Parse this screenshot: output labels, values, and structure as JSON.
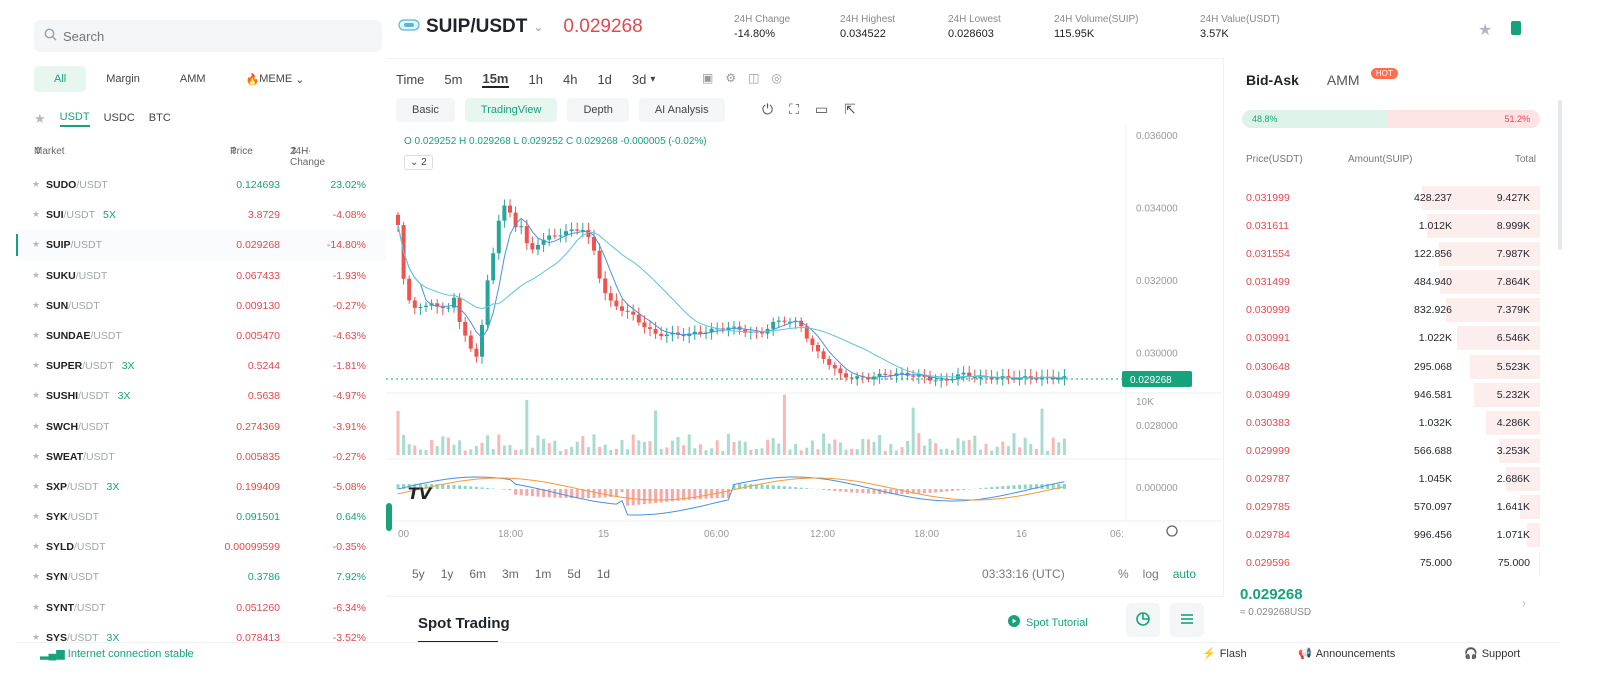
{
  "sidebar": {
    "search_placeholder": "Search",
    "categories": [
      "All",
      "Margin",
      "AMM",
      "MEME"
    ],
    "quotes": [
      "USDT",
      "USDC",
      "BTC"
    ],
    "headers": {
      "market": "Market",
      "price": "Price",
      "change": "24H Change"
    },
    "rows": [
      {
        "sym": "SUDO",
        "quote": "/USDT",
        "lev": "",
        "price": "0.124693",
        "change": "23.02%",
        "dir": "up"
      },
      {
        "sym": "SUI",
        "quote": "/USDT",
        "lev": "5X",
        "price": "3.8729",
        "change": "-4.08%",
        "dir": "down"
      },
      {
        "sym": "SUIP",
        "quote": "/USDT",
        "lev": "",
        "price": "0.029268",
        "change": "-14.80%",
        "dir": "down",
        "selected": true
      },
      {
        "sym": "SUKU",
        "quote": "/USDT",
        "lev": "",
        "price": "0.067433",
        "change": "-1.93%",
        "dir": "down"
      },
      {
        "sym": "SUN",
        "quote": "/USDT",
        "lev": "",
        "price": "0.009130",
        "change": "-0.27%",
        "dir": "down"
      },
      {
        "sym": "SUNDAE",
        "quote": "/USDT",
        "lev": "",
        "price": "0.005470",
        "change": "-4.63%",
        "dir": "down"
      },
      {
        "sym": "SUPER",
        "quote": "/USDT",
        "lev": "3X",
        "price": "0.5244",
        "change": "-1.81%",
        "dir": "down"
      },
      {
        "sym": "SUSHI",
        "quote": "/USDT",
        "lev": "3X",
        "price": "0.5638",
        "change": "-4.97%",
        "dir": "down"
      },
      {
        "sym": "SWCH",
        "quote": "/USDT",
        "lev": "",
        "price": "0.274369",
        "change": "-3.91%",
        "dir": "down"
      },
      {
        "sym": "SWEAT",
        "quote": "/USDT",
        "lev": "",
        "price": "0.005835",
        "change": "-0.27%",
        "dir": "down"
      },
      {
        "sym": "SXP",
        "quote": "/USDT",
        "lev": "3X",
        "price": "0.199409",
        "change": "-5.08%",
        "dir": "down"
      },
      {
        "sym": "SYK",
        "quote": "/USDT",
        "lev": "",
        "price": "0.091501",
        "change": "0.64%",
        "dir": "up"
      },
      {
        "sym": "SYLD",
        "quote": "/USDT",
        "lev": "",
        "price": "0.00099599",
        "change": "-0.35%",
        "dir": "down"
      },
      {
        "sym": "SYN",
        "quote": "/USDT",
        "lev": "",
        "price": "0.3786",
        "change": "7.92%",
        "dir": "up"
      },
      {
        "sym": "SYNT",
        "quote": "/USDT",
        "lev": "",
        "price": "0.051260",
        "change": "-6.34%",
        "dir": "down"
      },
      {
        "sym": "SYS",
        "quote": "/USDT",
        "lev": "3X",
        "price": "0.078413",
        "change": "-3.52%",
        "dir": "down"
      }
    ]
  },
  "header": {
    "pair": "SUIP/USDT",
    "last_price": "0.029268",
    "stats": [
      {
        "label": "24H Change",
        "value": "-14.80%",
        "color": "#e5484d"
      },
      {
        "label": "24H Highest",
        "value": "0.034522"
      },
      {
        "label": "24H Lowest",
        "value": "0.028603"
      },
      {
        "label": "24H Volume(SUIP)",
        "value": "115.95K"
      },
      {
        "label": "24H Value(USDT)",
        "value": "3.57K"
      }
    ]
  },
  "chart_toolbar": {
    "timeframes": [
      "Time",
      "5m",
      "15m",
      "1h",
      "4h",
      "1d",
      "3d"
    ],
    "active_timeframe": "15m",
    "views": [
      "Basic",
      "TradingView",
      "Depth",
      "AI Analysis"
    ],
    "active_view": "TradingView",
    "ohlc": "O 0.029252  H 0.029268  L 0.029252  C 0.029268  -0.000005 (-0.02%)",
    "indicator_toggle": "2",
    "range_buttons": [
      "5y",
      "1y",
      "6m",
      "3m",
      "1m",
      "5d",
      "1d"
    ],
    "clock": "03:33:16 (UTC)",
    "scale_options": [
      "%",
      "log",
      "auto"
    ]
  },
  "chart_data": {
    "type": "candlestick",
    "y_axis_ticks": [
      "0.036000",
      "0.034000",
      "0.032000",
      "0.030000",
      "0.028000"
    ],
    "ylim": [
      0.028,
      0.036
    ],
    "last_price_label": "0.029268",
    "volume_axis_tick": "10K",
    "macd_axis_tick": "0.000000",
    "x_axis_ticks": [
      "00",
      "18:00",
      "15",
      "06:00",
      "12:00",
      "18:00",
      "16",
      "06:"
    ],
    "colors": {
      "up": "#26a69a",
      "down": "#ef5350",
      "ma_fast": "#4a90e2",
      "ma_slow": "#5cc7d6",
      "macd": "#4a90e2",
      "signal": "#f59a3c"
    }
  },
  "spot": {
    "title": "Spot Trading",
    "tutorial": "Spot Tutorial"
  },
  "orderbook": {
    "tabs": [
      "Bid-Ask",
      "AMM"
    ],
    "hot_badge": "HOT",
    "buy_ratio": "48.8%",
    "sell_ratio": "51.2%",
    "buy_pct": 48.8,
    "headers": {
      "price": "Price(USDT)",
      "amount": "Amount(SUIP)",
      "total": "Total"
    },
    "asks": [
      {
        "price": "0.031999",
        "amount": "428.237",
        "total": "9.427K",
        "depth": 0.98
      },
      {
        "price": "0.031611",
        "amount": "1.012K",
        "total": "8.999K",
        "depth": 0.94
      },
      {
        "price": "0.031554",
        "amount": "122.856",
        "total": "7.987K",
        "depth": 0.84
      },
      {
        "price": "0.031499",
        "amount": "484.940",
        "total": "7.864K",
        "depth": 0.83
      },
      {
        "price": "0.030999",
        "amount": "832.926",
        "total": "7.379K",
        "depth": 0.78
      },
      {
        "price": "0.030991",
        "amount": "1.022K",
        "total": "6.546K",
        "depth": 0.69
      },
      {
        "price": "0.030648",
        "amount": "295.068",
        "total": "5.523K",
        "depth": 0.58
      },
      {
        "price": "0.030499",
        "amount": "946.581",
        "total": "5.232K",
        "depth": 0.55
      },
      {
        "price": "0.030383",
        "amount": "1.032K",
        "total": "4.286K",
        "depth": 0.45
      },
      {
        "price": "0.029999",
        "amount": "566.688",
        "total": "3.253K",
        "depth": 0.34
      },
      {
        "price": "0.029787",
        "amount": "1.045K",
        "total": "2.686K",
        "depth": 0.28
      },
      {
        "price": "0.029785",
        "amount": "570.097",
        "total": "1.641K",
        "depth": 0.17
      },
      {
        "price": "0.029784",
        "amount": "996.456",
        "total": "1.071K",
        "depth": 0.11
      },
      {
        "price": "0.029596",
        "amount": "75.000",
        "total": "75.000",
        "depth": 0.01
      }
    ],
    "mid_price": "0.029268",
    "mid_usd": "≈ 0.029268USD"
  },
  "footer": {
    "connection": "Internet connection stable",
    "links": [
      "Flash",
      "Announcements",
      "Support"
    ]
  }
}
